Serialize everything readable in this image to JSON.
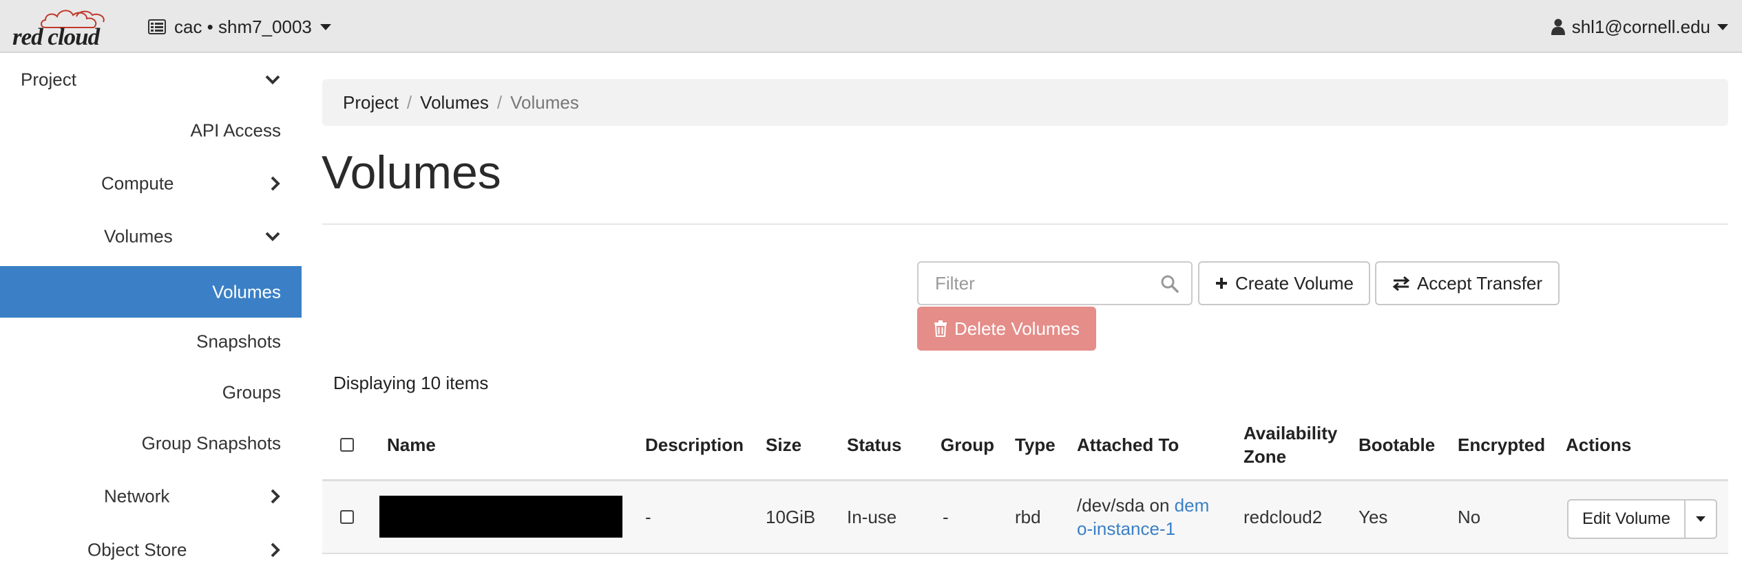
{
  "header": {
    "logo_text": "red cloud",
    "project_picker": "cac • shm7_0003",
    "user": "shl1@cornell.edu"
  },
  "sidebar": {
    "items": [
      {
        "label": "Project",
        "chevron": "down"
      },
      {
        "label": "API Access"
      },
      {
        "label": "Compute",
        "chevron": "right"
      },
      {
        "label": "Volumes",
        "chevron": "down"
      },
      {
        "label": "Volumes",
        "active": true
      },
      {
        "label": "Snapshots"
      },
      {
        "label": "Groups"
      },
      {
        "label": "Group Snapshots"
      },
      {
        "label": "Network",
        "chevron": "right"
      },
      {
        "label": "Object Store",
        "chevron": "right"
      }
    ]
  },
  "breadcrumb": {
    "items": [
      "Project",
      "Volumes"
    ],
    "current": "Volumes"
  },
  "page": {
    "title": "Volumes"
  },
  "toolbar": {
    "filter_placeholder": "Filter",
    "create_label": "Create Volume",
    "accept_label": "Accept Transfer",
    "delete_label": "Delete Volumes"
  },
  "table": {
    "count_text": "Displaying 10 items",
    "columns": {
      "name": "Name",
      "description": "Description",
      "size": "Size",
      "status": "Status",
      "group": "Group",
      "type": "Type",
      "attached_to": "Attached To",
      "availability_zone_1": "Availability",
      "availability_zone_2": "Zone",
      "bootable": "Bootable",
      "encrypted": "Encrypted",
      "actions": "Actions"
    },
    "rows": [
      {
        "name": "",
        "description": "-",
        "size": "10GiB",
        "status": "In-use",
        "group": "-",
        "type": "rbd",
        "attached_prefix": "/dev/sda on ",
        "attached_link_1": "dem",
        "attached_link_2": "o-instance-1",
        "availability_zone": "redcloud2",
        "bootable": "Yes",
        "encrypted": "No",
        "action_label": "Edit Volume"
      }
    ]
  },
  "colors": {
    "accent": "#3b80c6",
    "danger": "#e58d89",
    "navbar": "#e8e8e8",
    "logo_cloud": "#c0392b"
  }
}
